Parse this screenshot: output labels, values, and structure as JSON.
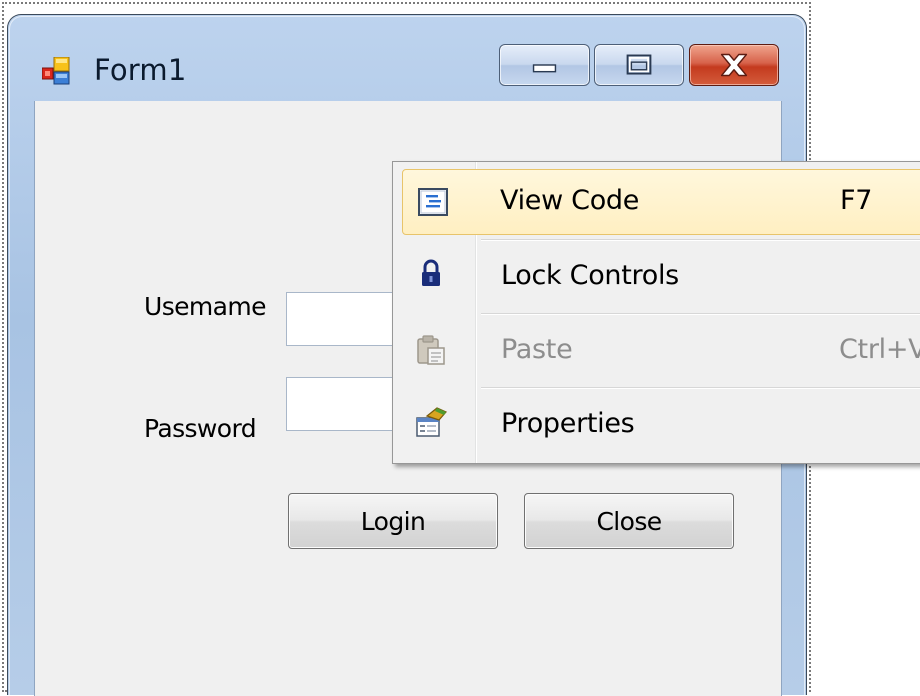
{
  "window": {
    "title": "Form1"
  },
  "form": {
    "username_label": "Usemame",
    "password_label": "Password",
    "login_button": "Login",
    "close_button": "Close"
  },
  "context_menu": {
    "items": [
      {
        "label": "View Code",
        "shortcut": "F7",
        "icon": "view-code-icon",
        "enabled": true,
        "highlighted": true
      },
      {
        "label": "Lock Controls",
        "shortcut": "",
        "icon": "lock-icon",
        "enabled": true,
        "highlighted": false
      },
      {
        "label": "Paste",
        "shortcut": "Ctrl+V",
        "icon": "paste-icon",
        "enabled": false,
        "highlighted": false
      },
      {
        "label": "Properties",
        "shortcut": "",
        "icon": "properties-icon",
        "enabled": true,
        "highlighted": false
      }
    ]
  },
  "colors": {
    "title_bar": "#bdd3ee",
    "client_area": "#f0f0f0",
    "close_button": "#c43a1e",
    "menu_highlight": "#ffefc2",
    "menu_highlight_border": "#e8c46a",
    "disabled_text": "#8d8d8d"
  }
}
